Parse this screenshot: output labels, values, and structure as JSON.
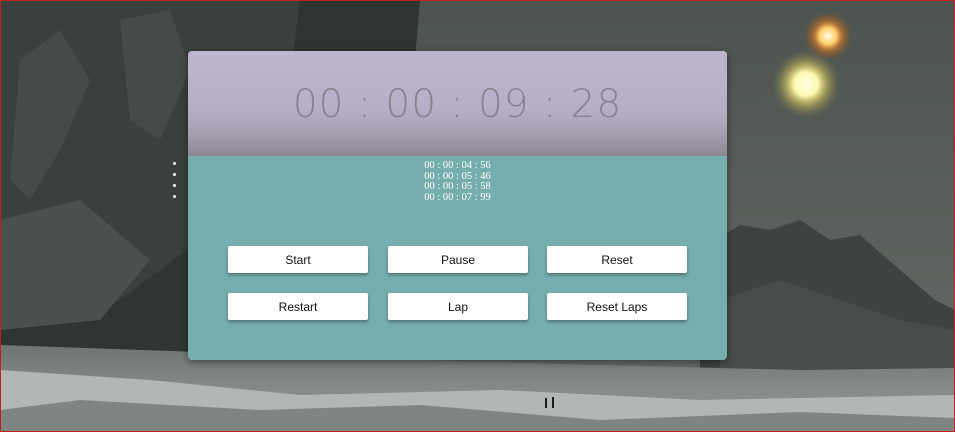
{
  "stopwatch": {
    "time": "00 : 00 : 09 : 28",
    "laps": [
      "00 : 00 : 04 : 56",
      "00 : 00 : 05 : 46",
      "00 : 00 : 05 : 58",
      "00 : 00 : 07 : 99"
    ],
    "buttons": {
      "start": "Start",
      "pause": "Pause",
      "reset": "Reset",
      "restart": "Restart",
      "lap": "Lap",
      "reset_laps": "Reset Laps"
    }
  },
  "colors": {
    "display_bg": "#bfb6cd",
    "panel_bg": "#76adad",
    "time_text": "#8a8390"
  }
}
